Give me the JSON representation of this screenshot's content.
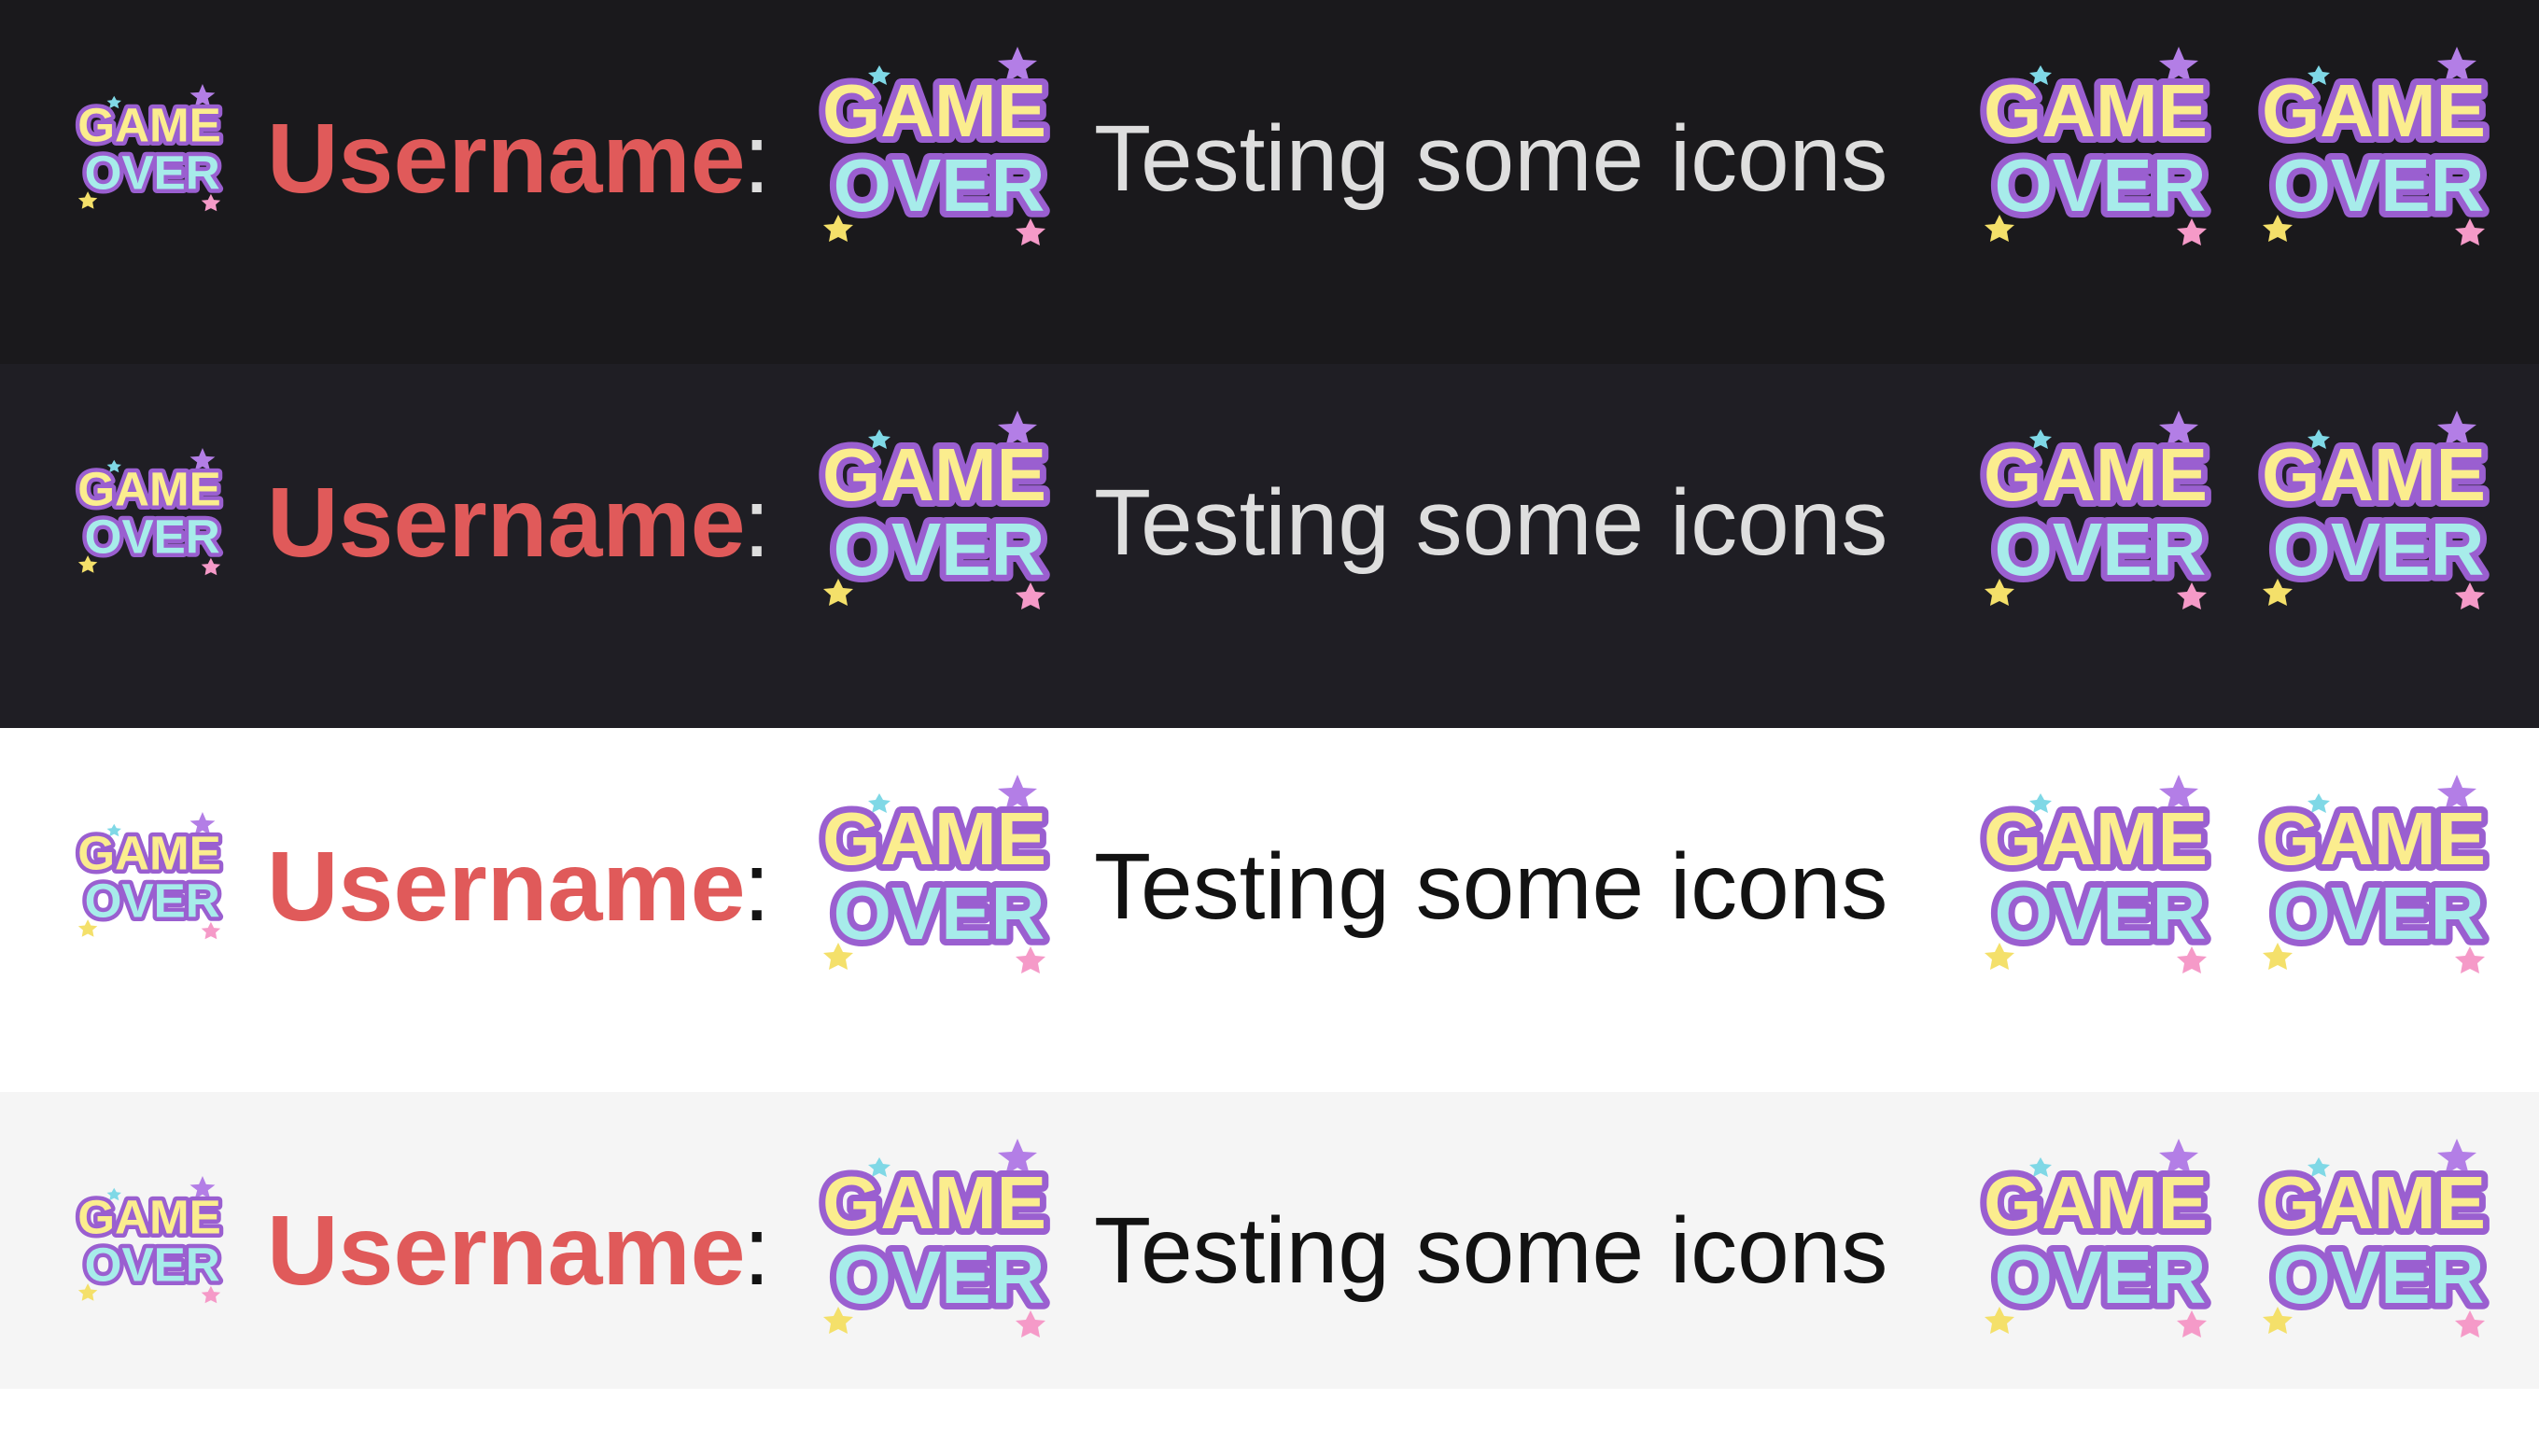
{
  "rows": [
    {
      "theme": "dark",
      "bg": "#1a191c",
      "text_color": "#dedede"
    },
    {
      "theme": "dim",
      "bg": "#1f1e24",
      "text_color": "#dedede"
    },
    {
      "theme": "light",
      "bg": "#ffffff",
      "text_color": "#121212"
    },
    {
      "theme": "lightgray",
      "bg": "#f5f5f5",
      "text_color": "#121212"
    }
  ],
  "message": {
    "username": "Username",
    "colon": ":",
    "text": "Testing some icons"
  },
  "badge": {
    "line1": "GAME",
    "line2": "OVER",
    "colors": {
      "game_fill": "#fbed8e",
      "over_fill": "#a7ecea",
      "outline": "#9a5fd0",
      "star_purple": "#b37ee6",
      "star_cyan": "#7fd8e6",
      "star_yellow": "#f4e06a",
      "star_pink": "#f59ac8"
    }
  },
  "colors": {
    "username": "#e05a5a"
  }
}
